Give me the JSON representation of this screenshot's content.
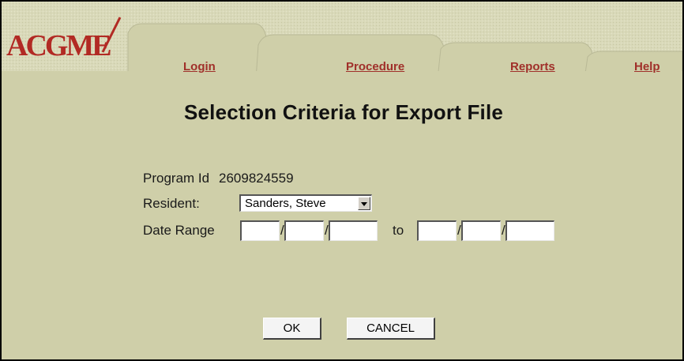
{
  "logo": {
    "text": "ACGME"
  },
  "nav": {
    "login": "Login",
    "procedure": "Procedure",
    "reports": "Reports",
    "help": "Help"
  },
  "page": {
    "title": "Selection Criteria for Export File"
  },
  "form": {
    "program_id_label": "Program Id",
    "program_id_value": "2609824559",
    "resident_label": "Resident:",
    "resident_selected": "Sanders, Steve",
    "date_range_label": "Date Range",
    "separator": "/",
    "to_label": "to",
    "date_from": {
      "month": "",
      "day": "",
      "year": ""
    },
    "date_to": {
      "month": "",
      "day": "",
      "year": ""
    }
  },
  "buttons": {
    "ok": "OK",
    "cancel": "CANCEL"
  },
  "colors": {
    "background": "#cfcfa9",
    "tab": "#d6d6b4",
    "link": "#a0302a",
    "logo": "#b22a24"
  }
}
